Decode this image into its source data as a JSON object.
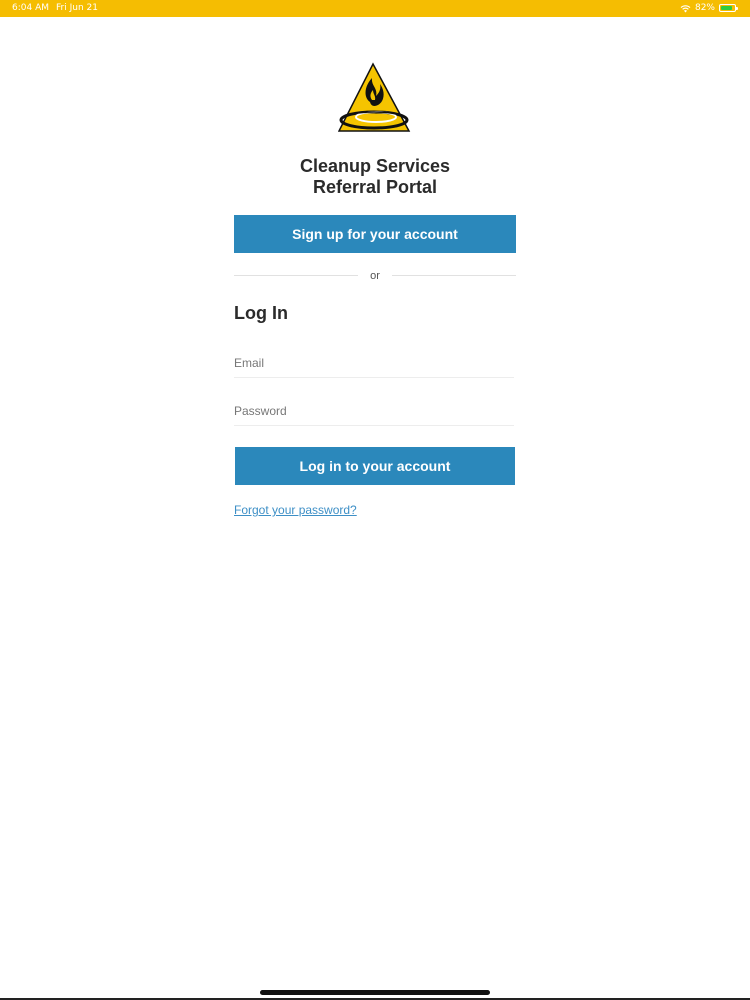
{
  "status_bar": {
    "time": "6:04 AM",
    "date": "Fri Jun 21",
    "battery": "82%",
    "background_color": "#f5bd02"
  },
  "app": {
    "title_line1": "Cleanup Services",
    "title_line2": "Referral Portal",
    "logo_icon": "flame-triangle-logo"
  },
  "signup": {
    "button_label": "Sign up for your account"
  },
  "divider": {
    "text": "or"
  },
  "login": {
    "heading": "Log In",
    "email_placeholder": "Email",
    "email_value": "",
    "password_placeholder": "Password",
    "password_value": "",
    "button_label": "Log in to your account",
    "forgot_link": "Forgot your password?"
  },
  "colors": {
    "accent": "#2b88bb",
    "link": "#3d8fc6",
    "brand_yellow": "#f5c400"
  }
}
